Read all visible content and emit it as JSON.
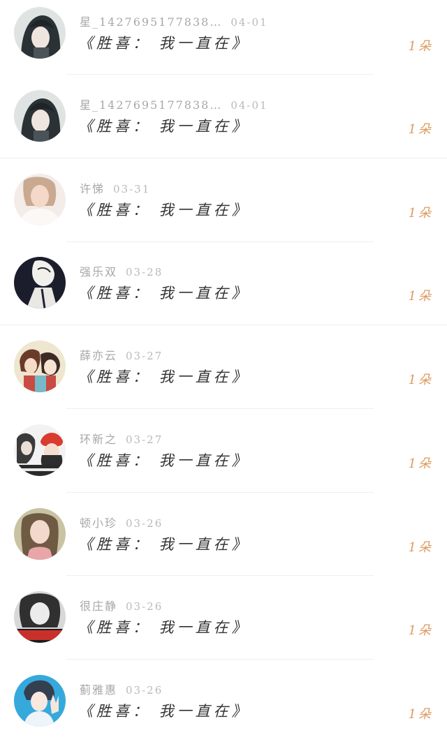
{
  "gifts": [
    {
      "name": "星_1427695177838…",
      "date": "04-01",
      "title": "《胜喜：  我一直在》",
      "count": "1朵",
      "avatar_icon": "avatar-anime-dark-hair"
    },
    {
      "name": "星_1427695177838…",
      "date": "04-01",
      "title": "《胜喜：  我一直在》",
      "count": "1朵",
      "avatar_icon": "avatar-anime-dark-hair"
    },
    {
      "name": "许悌",
      "date": "03-31",
      "title": "《胜喜：  我一直在》",
      "count": "1朵",
      "avatar_icon": "avatar-bride-photo"
    },
    {
      "name": "强乐双",
      "date": "03-28",
      "title": "《胜喜：  我一直在》",
      "count": "1朵",
      "avatar_icon": "avatar-sketch-figure"
    },
    {
      "name": "薛亦云",
      "date": "03-27",
      "title": "《胜喜：  我一直在》",
      "count": "1朵",
      "avatar_icon": "avatar-anime-couple"
    },
    {
      "name": "环新之",
      "date": "03-27",
      "title": "《胜喜：  我一直在》",
      "count": "1朵",
      "avatar_icon": "avatar-red-hat-illustration"
    },
    {
      "name": "顿小珍",
      "date": "03-26",
      "title": "《胜喜：  我一直在》",
      "count": "1朵",
      "avatar_icon": "avatar-girl-photo"
    },
    {
      "name": "很庄静",
      "date": "03-26",
      "title": "《胜喜：  我一直在》",
      "count": "1朵",
      "avatar_icon": "avatar-bw-girl-photo"
    },
    {
      "name": "蓟雅惠",
      "date": "03-26",
      "title": "《胜喜：  我一直在》",
      "count": "1朵",
      "avatar_icon": "avatar-anime-boy-blue"
    }
  ],
  "colors": {
    "name": "#a7a7a7",
    "title": "#333333",
    "count": "#dd9a5e",
    "divider": "#efefef"
  }
}
